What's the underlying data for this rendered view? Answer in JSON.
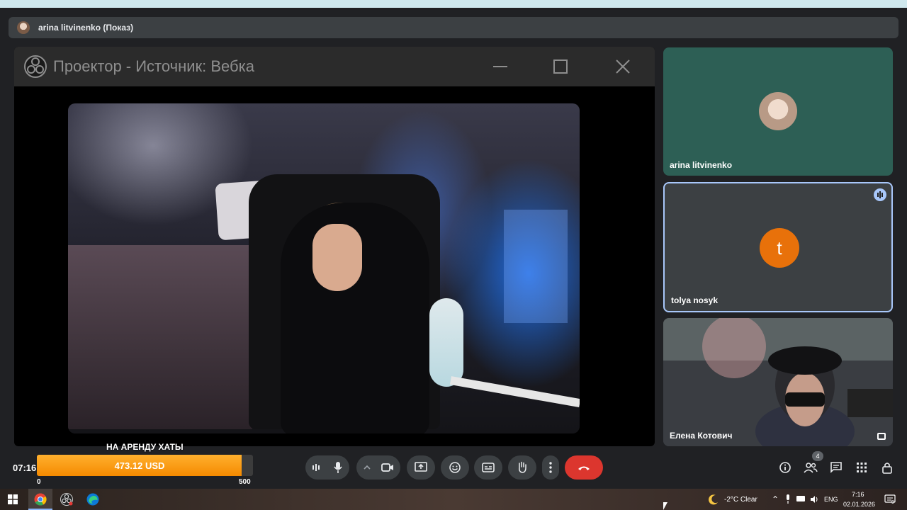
{
  "presenter_bar": {
    "label": "arina litvinenko (Показ)"
  },
  "projector": {
    "title": "Проектор - Источник: Вебка"
  },
  "participants": [
    {
      "name": "arina litvinenko",
      "avatar": "photo"
    },
    {
      "name": "tolya nosyk",
      "avatar_letter": "t",
      "avatar_color": "#e8710a",
      "speaking": true
    },
    {
      "name": "Елена Котович",
      "avatar": "video"
    }
  ],
  "meeting": {
    "time": "07:16",
    "participant_count": "4"
  },
  "goal": {
    "title": "НА АРЕНДУ ХАТЫ",
    "amount": "473.12 USD",
    "min": "0",
    "max": "500",
    "value": 473.12
  },
  "controls": {
    "icons": [
      "audio-levels-icon",
      "mic-icon",
      "more-options-chevron-icon",
      "camera-icon",
      "present-screen-icon",
      "emoji-icon",
      "captions-icon",
      "raise-hand-icon",
      "more-vert-icon",
      "end-call-icon"
    ],
    "end_call_color": "#dc362e"
  },
  "right_controls": [
    "info-icon",
    "people-icon",
    "chat-icon",
    "activities-icon",
    "host-controls-icon"
  ],
  "taskbar": {
    "weather": "-2°C  Clear",
    "language": "ENG",
    "time": "7:16",
    "date": "02.01.2026",
    "notification_count": "9"
  }
}
